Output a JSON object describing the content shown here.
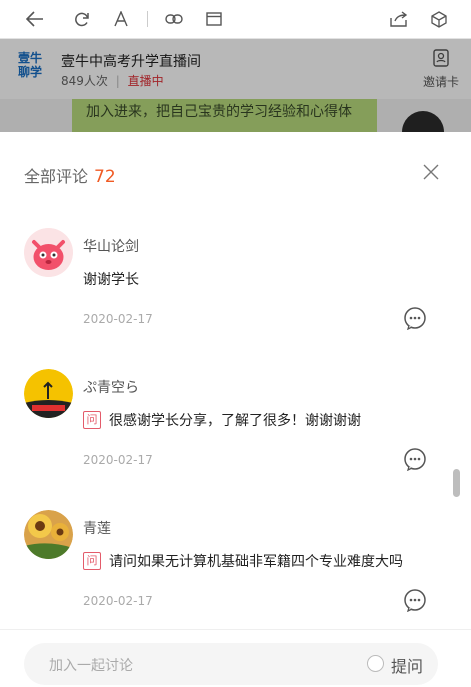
{
  "toolbar": {
    "icons": [
      "back-icon",
      "refresh-icon",
      "font-size-icon",
      "link-icon",
      "window-icon",
      "share-icon",
      "cube-icon"
    ]
  },
  "live": {
    "logo_line1": "壹牛",
    "logo_line2": "聊学",
    "title": "壹牛中高考升学直播间",
    "viewers": "849人次",
    "separator": "|",
    "status": "直播中",
    "invite_label": "邀请卡",
    "bubble_text": "加入进来，把自己宝贵的学习经验和心得体"
  },
  "panel": {
    "title": "全部评论",
    "count": "72"
  },
  "comments": [
    {
      "username": "华山论剑",
      "has_question_tag": false,
      "question_tag": "",
      "text": "谢谢学长",
      "date": "2020-02-17"
    },
    {
      "username": "ぷ青空ら",
      "has_question_tag": true,
      "question_tag": "问",
      "text": "很感谢学长分享，了解了很多！谢谢谢谢",
      "date": "2020-02-17"
    },
    {
      "username": "青莲",
      "has_question_tag": true,
      "question_tag": "问",
      "text": "请问如果无计算机基础非军籍四个专业难度大吗",
      "date": "2020-02-17"
    }
  ],
  "input": {
    "placeholder": "加入一起讨论",
    "ask_label": "提问"
  },
  "colors": {
    "accent": "#f05a23",
    "question_tag": "#e35b6a",
    "live_status": "#e0333a"
  }
}
